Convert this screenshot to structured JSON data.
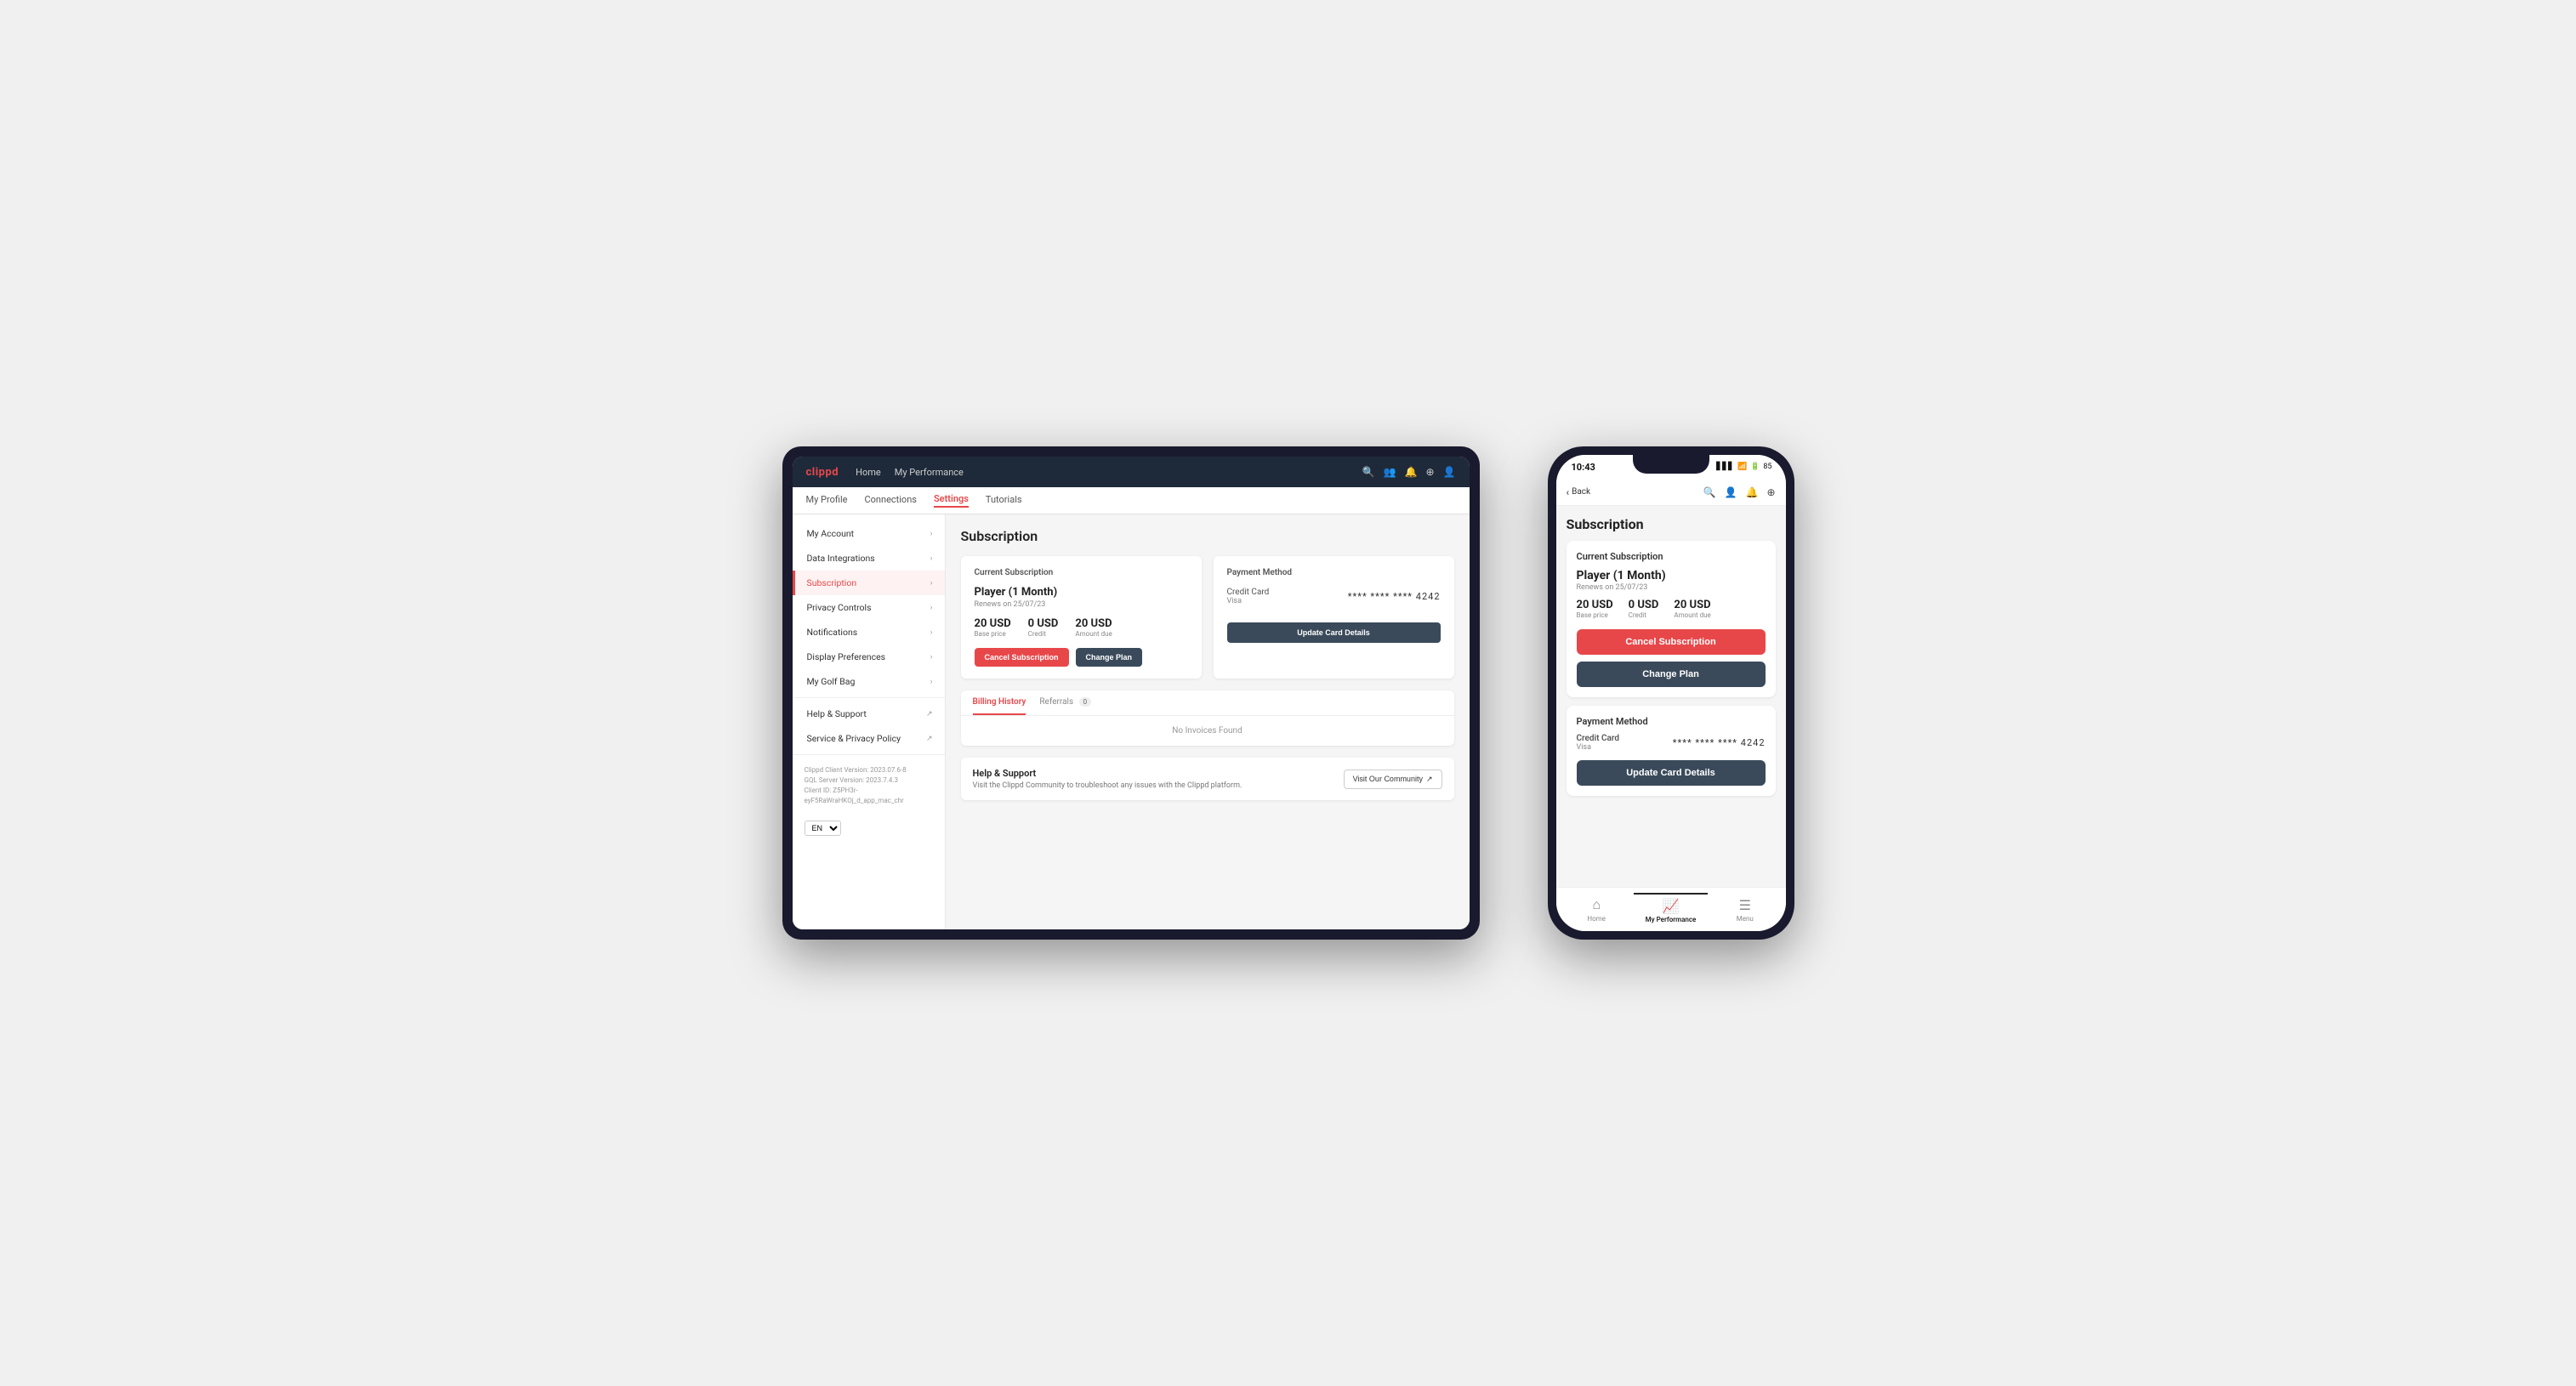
{
  "tablet": {
    "logo": "clippd",
    "topnav": {
      "links": [
        "Home",
        "My Performance"
      ],
      "icons": [
        "search",
        "people",
        "bell",
        "help",
        "user"
      ]
    },
    "subnav": {
      "items": [
        "My Profile",
        "Connections",
        "Settings",
        "Tutorials"
      ],
      "active": "Settings"
    },
    "sidebar": {
      "items": [
        {
          "label": "My Account",
          "active": false
        },
        {
          "label": "Data Integrations",
          "active": false
        },
        {
          "label": "Subscription",
          "active": true
        },
        {
          "label": "Privacy Controls",
          "active": false
        },
        {
          "label": "Notifications",
          "active": false
        },
        {
          "label": "Display Preferences",
          "active": false
        },
        {
          "label": "My Golf Bag",
          "active": false
        },
        {
          "label": "Help & Support",
          "active": false,
          "external": true
        },
        {
          "label": "Service & Privacy Policy",
          "active": false,
          "external": true
        }
      ],
      "footer": {
        "line1": "Clippd Client Version: 2023.07.6-8",
        "line2": "GQL Server Version: 2023.7.4.3",
        "line3": "Client ID: Z5PH3r-eyF5RaWraHKOj_d_app_mac_chr"
      },
      "lang": "EN"
    },
    "main": {
      "page_title": "Subscription",
      "current_subscription": {
        "label": "Current Subscription",
        "plan_name": "Player (1 Month)",
        "renew_text": "Renews on 25/07/23",
        "base_price": "20 USD",
        "base_label": "Base price",
        "credit": "0 USD",
        "credit_label": "Credit",
        "amount_due": "20 USD",
        "amount_label": "Amount due",
        "btn_cancel": "Cancel Subscription",
        "btn_change": "Change Plan"
      },
      "payment_method": {
        "label": "Payment Method",
        "cc_type": "Credit Card",
        "cc_brand": "Visa",
        "cc_number": "**** **** **** 4242",
        "btn_update": "Update Card Details"
      },
      "billing": {
        "tab_billing": "Billing History",
        "tab_referrals": "Referrals",
        "referral_count": "0",
        "empty_text": "No Invoices Found"
      },
      "help": {
        "title": "Help & Support",
        "description": "Visit the Clippd Community to troubleshoot any issues with the Clippd platform.",
        "btn_community": "Visit Our Community"
      }
    }
  },
  "phone": {
    "statusbar": {
      "time": "10:43",
      "signal": "▋▋▋",
      "wifi": "WiFi",
      "battery": "85"
    },
    "topnav": {
      "back_label": "Back",
      "icons": [
        "search",
        "person",
        "bell",
        "add"
      ]
    },
    "page_title": "Subscription",
    "current_subscription": {
      "label": "Current Subscription",
      "plan_name": "Player (1 Month)",
      "renew_text": "Renews on 25/07/23",
      "base_price": "20 USD",
      "base_label": "Base price",
      "credit": "0 USD",
      "credit_label": "Credit",
      "amount_due": "20 USD",
      "amount_label": "Amount due",
      "btn_cancel": "Cancel Subscription",
      "btn_change": "Change Plan"
    },
    "payment_method": {
      "label": "Payment Method",
      "cc_type": "Credit Card",
      "cc_brand": "Visa",
      "cc_number": "**** **** **** 4242",
      "btn_update": "Update Card Details"
    },
    "bottomnav": {
      "items": [
        {
          "label": "Home",
          "icon": "⌂",
          "active": false
        },
        {
          "label": "My Performance",
          "icon": "📈",
          "active": true
        },
        {
          "label": "Menu",
          "icon": "☰",
          "active": false
        }
      ]
    }
  }
}
